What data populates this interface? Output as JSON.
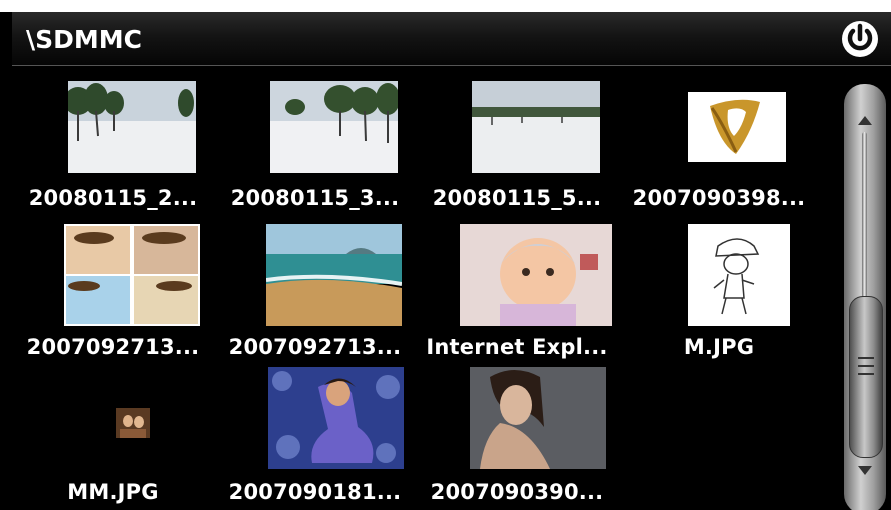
{
  "window": {
    "title": "\\SDMMC",
    "power_icon": "power-icon"
  },
  "files": [
    {
      "label": "20080115_2...",
      "thumb": "snow-trees-1"
    },
    {
      "label": "20080115_3...",
      "thumb": "snow-trees-2"
    },
    {
      "label": "20080115_5...",
      "thumb": "snow-field"
    },
    {
      "label": "2007090398...",
      "thumb": "gold-ring"
    },
    {
      "label": "2007092713...",
      "thumb": "beach-collage"
    },
    {
      "label": "2007092713...",
      "thumb": "beach-shore"
    },
    {
      "label": "Internet Expl...",
      "thumb": "baby-photo"
    },
    {
      "label": "M.JPG",
      "thumb": "cartoon-sketch"
    },
    {
      "label": "MM.JPG",
      "thumb": "small-photo"
    },
    {
      "label": "2007090181...",
      "thumb": "woman-blue"
    },
    {
      "label": "2007090390...",
      "thumb": "woman-portrait"
    }
  ],
  "scrollbar": {
    "position": 0.75
  }
}
